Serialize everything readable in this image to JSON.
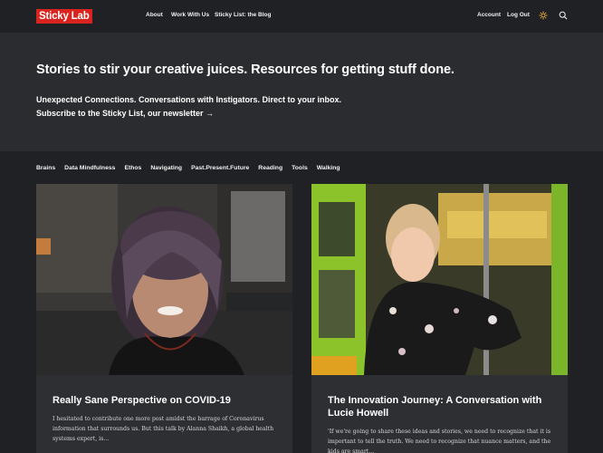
{
  "header": {
    "logo_text": "Sticky Lab",
    "nav": [
      {
        "label": "About"
      },
      {
        "label": "Work With Us"
      },
      {
        "label": "Sticky List: the Blog"
      }
    ],
    "account_label": "Account",
    "logout_label": "Log Out",
    "icons": [
      "sun-icon",
      "search-icon"
    ]
  },
  "hero": {
    "title": "Stories to stir your creative juices. Resources for getting stuff done.",
    "subtitle": "Unexpected Connections. Conversations with Instigators. Direct to your inbox.",
    "cta": "Subscribe to the Sticky List, our newsletter →"
  },
  "categories": [
    "Brains",
    "Data Mindfulness",
    "Ethos",
    "Navigating",
    "Past.Present.Future",
    "Reading",
    "Tools",
    "Walking"
  ],
  "posts": [
    {
      "title": "Really Sane Perspective on COVID-19",
      "excerpt": "I hesitated to contribute one more post amidst the barrage of Coronavirus information that surrounds us. But this talk by Alanna Shaikh, a global health systems expert, is..."
    },
    {
      "title": "The Innovation Journey: A Conversation with Lucie Howell",
      "excerpt": "'If we're going to share these ideas and stories, we need to recognize that it is important to tell the truth. We need to recognize that nuance matters, and the kids are smart..."
    }
  ],
  "colors": {
    "background": "#202124",
    "hero": "#2b2c2f",
    "card": "#2e2f33",
    "brand": "#d8231f"
  }
}
